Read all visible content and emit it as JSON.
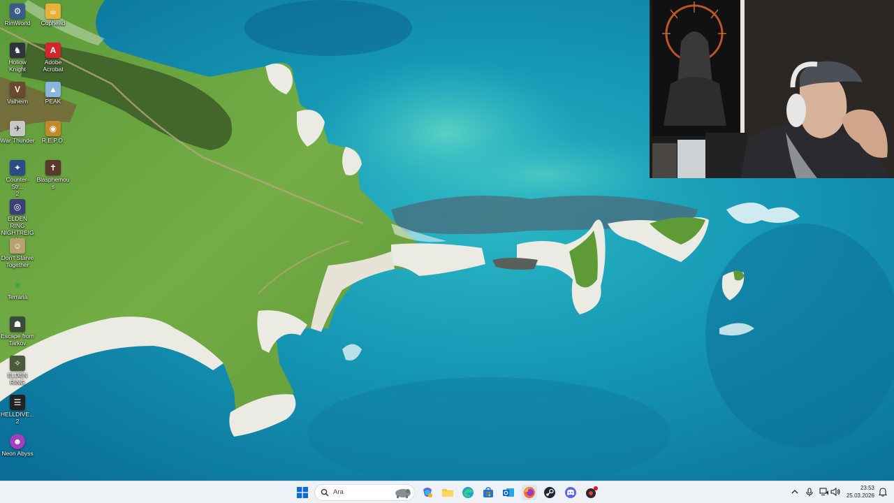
{
  "desktop": {
    "icons": [
      {
        "label": "RimWorld",
        "icon": "rimworld-icon",
        "color": "#3b5b8a"
      },
      {
        "label": "Cuphead",
        "icon": "cuphead-icon",
        "color": "#e8b13a"
      },
      {
        "label": "Hollow\nKnight",
        "icon": "hollow-knight-icon",
        "color": "#30343c"
      },
      {
        "label": "Adobe\nAcrobat",
        "icon": "adobe-acrobat-icon",
        "color": "#d4242c"
      },
      {
        "label": "Valheim",
        "icon": "valheim-icon",
        "color": "#6b4a2c"
      },
      {
        "label": "PEAK",
        "icon": "peak-icon",
        "color": "#8bb4e0"
      },
      {
        "label": "War Thunder",
        "icon": "war-thunder-icon",
        "color": "#c7c7c7"
      },
      {
        "label": "R.E.P.O.",
        "icon": "repo-icon",
        "color": "#c2892a"
      },
      {
        "label": "Counter-Str...\n2",
        "icon": "counter-strike-2-icon",
        "color": "#2a4d8a"
      },
      {
        "label": "Blasphemous",
        "icon": "blasphemous-icon",
        "color": "#5a3a2a"
      },
      {
        "label": "ELDEN RING\nNIGHTREIGN",
        "icon": "elden-ring-nightreign-icon",
        "color": "#3a3f7a"
      },
      {
        "label": "Don't Starve\nTogether",
        "icon": "dont-starve-together-icon",
        "color": "#b8a070"
      },
      {
        "label": "Terraria",
        "icon": "terraria-icon",
        "color": "#3aa83a"
      },
      {
        "label": "Escape from\nTarkov",
        "icon": "escape-from-tarkov-icon",
        "color": "#3a4a3a"
      },
      {
        "label": "ELDEN RING",
        "icon": "elden-ring-icon",
        "color": "#4a5a3a"
      },
      {
        "label": "HELLDIVE...\n2",
        "icon": "helldivers-2-icon",
        "color": "#222222"
      },
      {
        "label": "Neon Abyss",
        "icon": "neon-abyss-icon",
        "color": "#a040c0"
      }
    ]
  },
  "taskbar": {
    "search_placeholder": "Ara",
    "apps": [
      {
        "name": "start-button",
        "icon": "windows-icon"
      },
      {
        "name": "copilot-button",
        "icon": "copilot-icon"
      },
      {
        "name": "file-explorer-button",
        "icon": "folder-icon"
      },
      {
        "name": "edge-button",
        "icon": "edge-icon"
      },
      {
        "name": "store-button",
        "icon": "store-icon"
      },
      {
        "name": "outlook-button",
        "icon": "outlook-icon"
      },
      {
        "name": "firefox-button",
        "icon": "firefox-icon"
      },
      {
        "name": "steam-button",
        "icon": "steam-icon"
      },
      {
        "name": "discord-button",
        "icon": "discord-icon"
      },
      {
        "name": "recorder-button",
        "icon": "recorder-icon"
      }
    ],
    "tray": {
      "time": "23:53",
      "date": "25.03.2026"
    }
  },
  "colors": {
    "taskbar_bg": "#eef1f5",
    "accent": "#0a6cd6",
    "sea_deep": "#0b7fa6",
    "sea_light": "#26c2c8",
    "grass": "#6ea843",
    "cliff": "#ecebe3"
  }
}
